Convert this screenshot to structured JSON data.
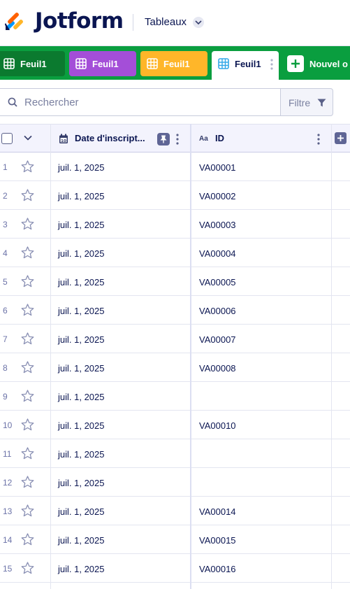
{
  "app": {
    "brand": "Jotform",
    "workspace": "Tableaux"
  },
  "tabs": [
    {
      "label": "Feuil1",
      "color": "#0b7a2f"
    },
    {
      "label": "Feuil1",
      "color": "#a44ed8"
    },
    {
      "label": "Feuil1",
      "color": "#ffb629"
    },
    {
      "label": "Feuil1",
      "color": "#ffffff",
      "active": true
    }
  ],
  "new_tab_label": "Nouvel o",
  "search": {
    "placeholder": "Rechercher"
  },
  "filter_label": "Filtre",
  "columns": {
    "date": "Date d'inscript...",
    "id": "ID"
  },
  "rows": [
    {
      "n": "1",
      "date": "juil. 1, 2025",
      "id": "VA00001"
    },
    {
      "n": "2",
      "date": "juil. 1, 2025",
      "id": "VA00002"
    },
    {
      "n": "3",
      "date": "juil. 1, 2025",
      "id": "VA00003"
    },
    {
      "n": "4",
      "date": "juil. 1, 2025",
      "id": "VA00004"
    },
    {
      "n": "5",
      "date": "juil. 1, 2025",
      "id": "VA00005"
    },
    {
      "n": "6",
      "date": "juil. 1, 2025",
      "id": "VA00006"
    },
    {
      "n": "7",
      "date": "juil. 1, 2025",
      "id": "VA00007"
    },
    {
      "n": "8",
      "date": "juil. 1, 2025",
      "id": "VA00008"
    },
    {
      "n": "9",
      "date": "juil. 1, 2025",
      "id": ""
    },
    {
      "n": "10",
      "date": "juil. 1, 2025",
      "id": "VA00010"
    },
    {
      "n": "11",
      "date": "juil. 1, 2025",
      "id": ""
    },
    {
      "n": "12",
      "date": "juil. 1, 2025",
      "id": ""
    },
    {
      "n": "13",
      "date": "juil. 1, 2025",
      "id": "VA00014"
    },
    {
      "n": "14",
      "date": "juil. 1, 2025",
      "id": "VA00015"
    },
    {
      "n": "15",
      "date": "juil. 1, 2025",
      "id": "VA00016"
    }
  ]
}
